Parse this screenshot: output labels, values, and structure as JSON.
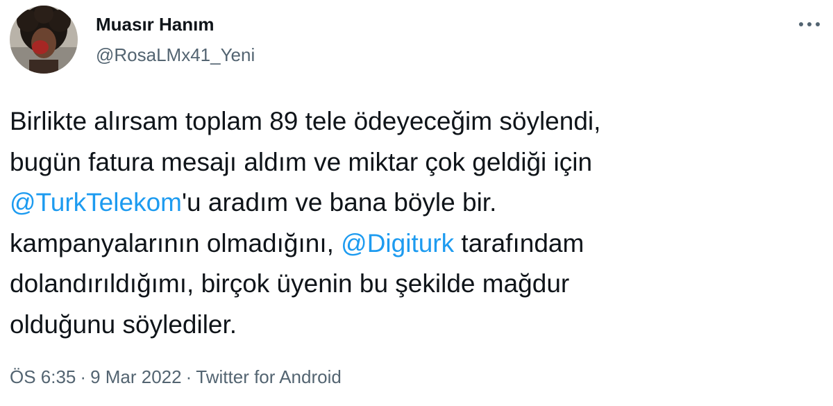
{
  "author": {
    "name": "Muasır Hanım",
    "handle": "@RosaLMx41_Yeni",
    "avatar_icon": "profile-photo"
  },
  "menu": {
    "icon": "more-options-icon",
    "glyph": "•••"
  },
  "tweet": {
    "line1": "Birlikte alırsam toplam 89 tele ödeyeceğim söylendi,",
    "line2": "bugün fatura mesajı aldım ve miktar çok geldiği için",
    "line3_mention": "@TurkTelekom",
    "line3_rest": "'u aradım ve bana böyle bir.",
    "line4_pre": "kampanyalarının olmadığını, ",
    "line4_mention": "@Digiturk",
    "line4_post": " tarafındam",
    "line5": "dolandırıldığımı, birçok üyenin bu şekilde mağdur",
    "line6": "olduğunu söylediler."
  },
  "meta": {
    "time": "ÖS 6:35",
    "separator": "·",
    "date": "9 Mar 2022",
    "source": "Twitter for Android"
  },
  "colors": {
    "text": "#0f1419",
    "secondary": "#536471",
    "link": "#1d9bf0"
  }
}
